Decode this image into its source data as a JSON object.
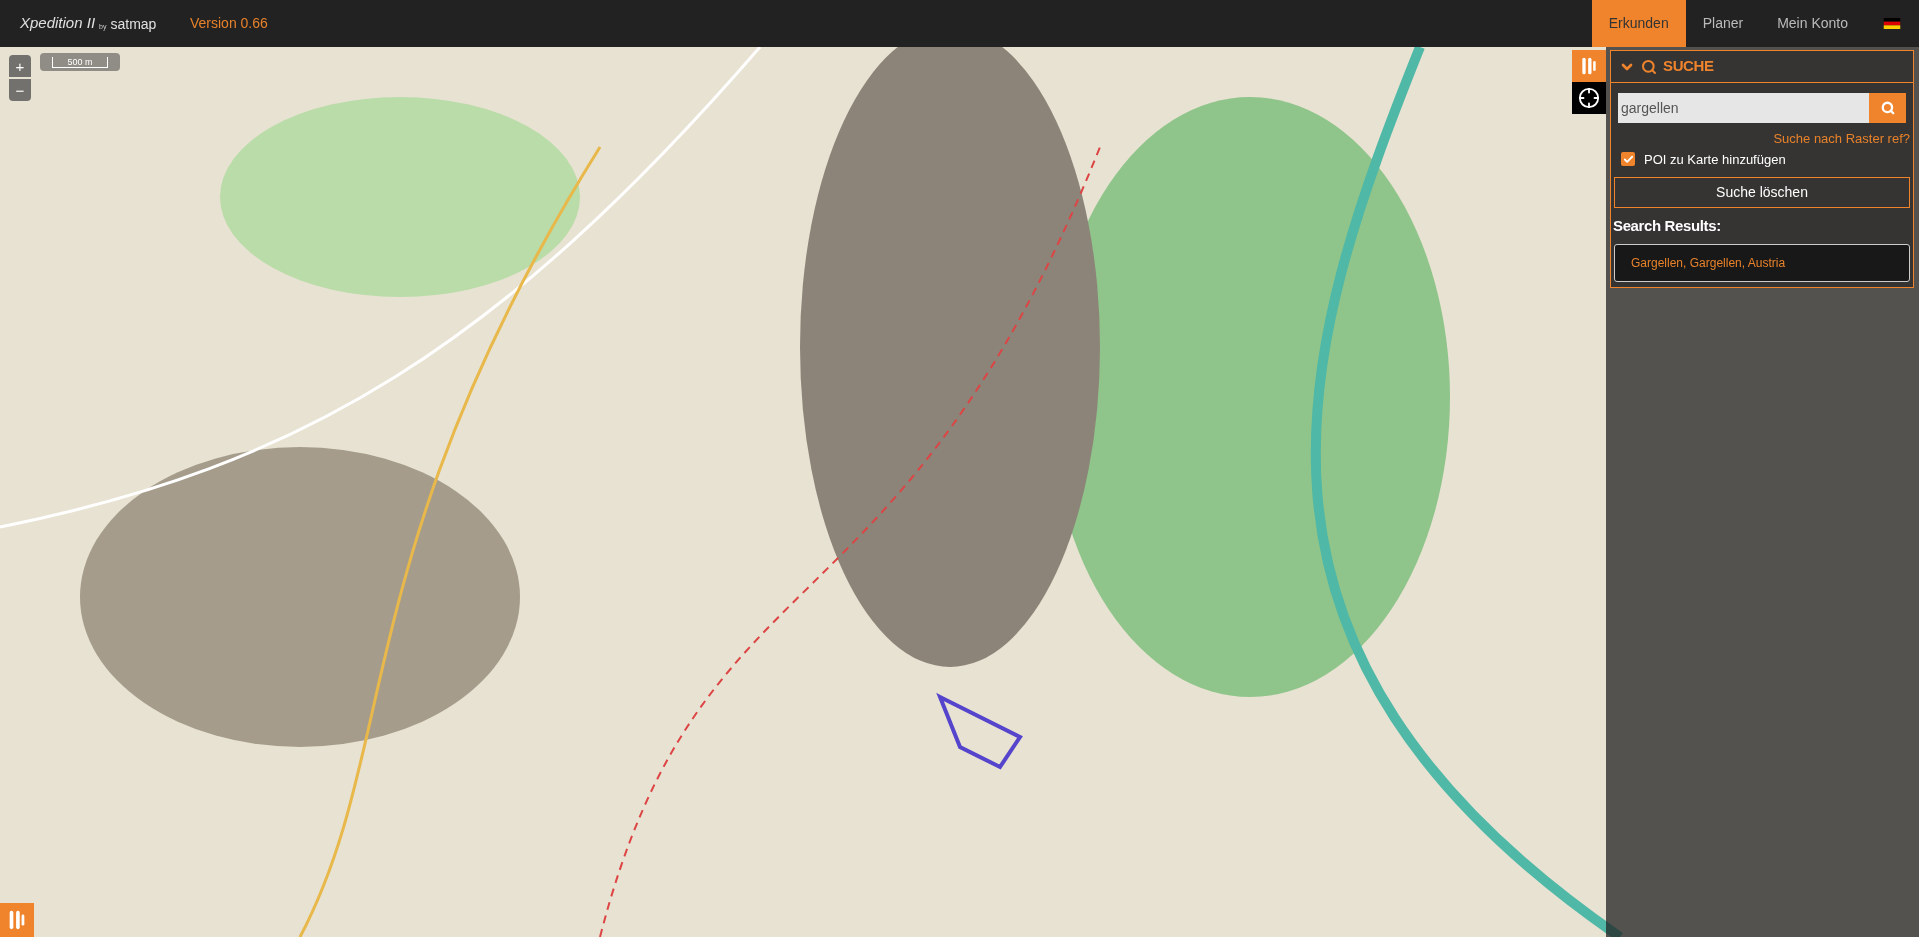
{
  "header": {
    "logo": {
      "name": "Xpedition II",
      "by": "by",
      "brand": "satmap"
    },
    "version": "Version 0.66",
    "nav": [
      {
        "label": "Erkunden",
        "selected": true
      },
      {
        "label": "Planer",
        "selected": false
      },
      {
        "label": "Mein Konto",
        "selected": false
      }
    ]
  },
  "map": {
    "zoom_in": "+",
    "zoom_out": "−",
    "scale": "500 m"
  },
  "search_panel": {
    "title": "SUCHE",
    "expanded": true,
    "query": "gargellen",
    "grid_ref_link": "Suche nach Raster ref?",
    "poi": {
      "label": "POI zu Karte hinzufügen",
      "checked": true
    },
    "clear_button": "Suche löschen",
    "results_title": "Search Results:",
    "results": [
      "Gargellen, Gargellen, Austria"
    ]
  }
}
